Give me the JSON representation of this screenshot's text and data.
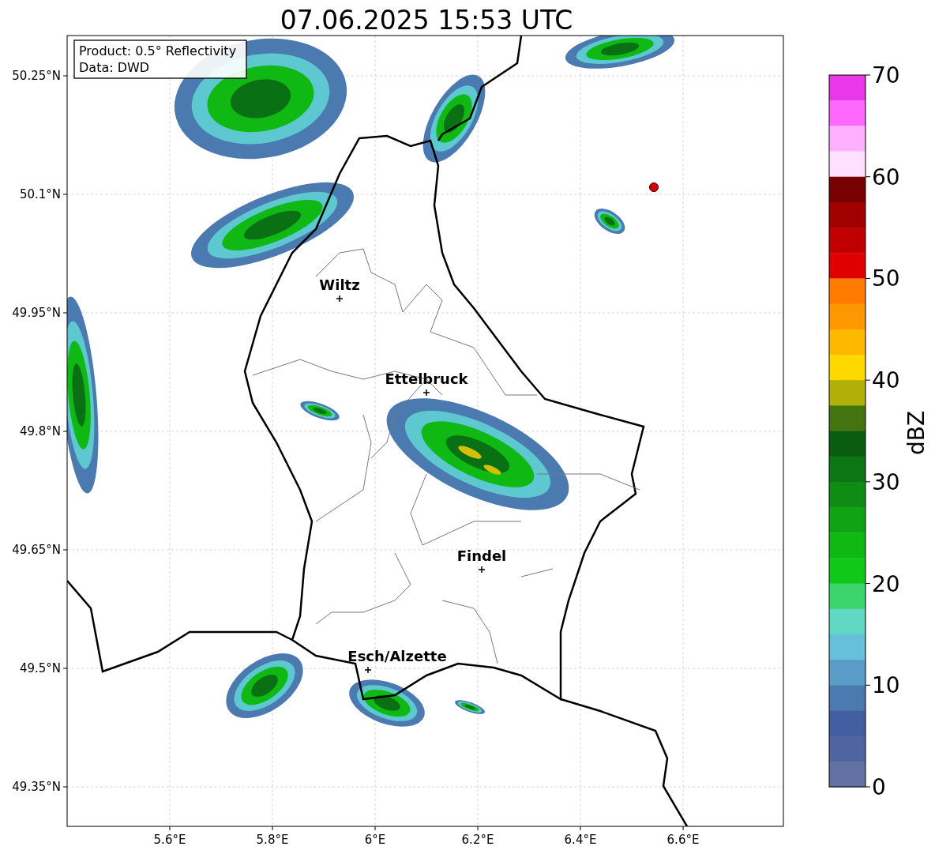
{
  "title": "07.06.2025 15:53 UTC",
  "info_box": [
    "Product: 0.5° Reflectivity",
    "Data: DWD"
  ],
  "lat_ticks": [
    "50.25°N",
    "50.1°N",
    "49.95°N",
    "49.8°N",
    "49.65°N",
    "49.5°N",
    "49.35°N"
  ],
  "lon_ticks": [
    "5.6°E",
    "5.8°E",
    "6°E",
    "6.2°E",
    "6.4°E",
    "6.6°E"
  ],
  "places": [
    {
      "name": "Wiltz"
    },
    {
      "name": "Ettelbruck"
    },
    {
      "name": "Findel"
    },
    {
      "name": "Esch/Alzette"
    }
  ],
  "colorbar": {
    "label": "dBZ",
    "ticks": [
      "70",
      "60",
      "50",
      "40",
      "30",
      "20",
      "10",
      "0"
    ],
    "bands": [
      {
        "color": "#e838e8"
      },
      {
        "color": "#ff68ff"
      },
      {
        "color": "#ffb0ff"
      },
      {
        "color": "#ffe0ff"
      },
      {
        "color": "#780000"
      },
      {
        "color": "#a00000"
      },
      {
        "color": "#c00000"
      },
      {
        "color": "#e00000"
      },
      {
        "color": "#ff7c00"
      },
      {
        "color": "#ff9800"
      },
      {
        "color": "#ffb800"
      },
      {
        "color": "#ffd800"
      },
      {
        "color": "#b0b008"
      },
      {
        "color": "#447410"
      },
      {
        "color": "#0a5c10"
      },
      {
        "color": "#0c7614"
      },
      {
        "color": "#0e8c14"
      },
      {
        "color": "#10a414"
      },
      {
        "color": "#10b814"
      },
      {
        "color": "#10c818"
      },
      {
        "color": "#3cd46c"
      },
      {
        "color": "#60d8c4"
      },
      {
        "color": "#66c0dc"
      },
      {
        "color": "#5a9cc8"
      },
      {
        "color": "#4a7ab0"
      },
      {
        "color": "#425ea0"
      },
      {
        "color": "#4f64a0"
      },
      {
        "color": "#6272a4"
      }
    ]
  }
}
